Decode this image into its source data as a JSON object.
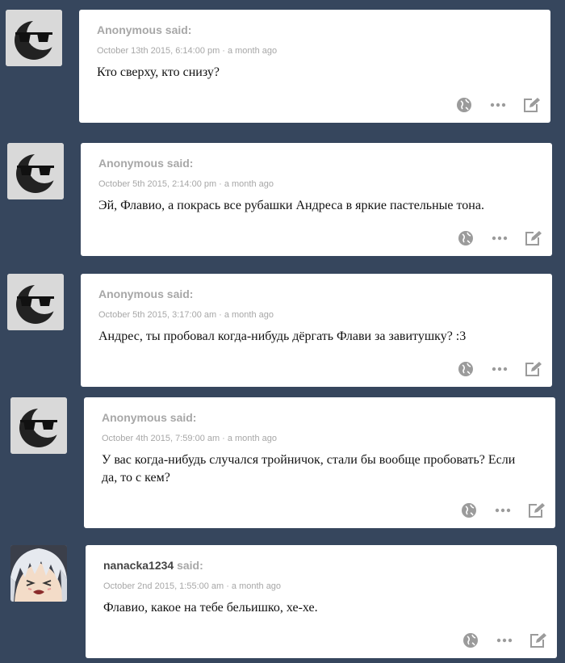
{
  "posts": [
    {
      "asker_name": "Anonymous",
      "said": "said:",
      "date": "October 13th 2015, 6:14:00 pm",
      "relative": "a month ago",
      "question": "Кто сверху, кто снизу?",
      "avatar_icon": "sunglasses-moon-icon"
    },
    {
      "asker_name": "Anonymous",
      "said": "said:",
      "date": "October 5th 2015, 2:14:00 pm",
      "relative": "a month ago",
      "question": "Эй, Флавио, а покрась все рубашки Андреса в яркие пастельные тона.",
      "avatar_icon": "sunglasses-moon-icon"
    },
    {
      "asker_name": "Anonymous",
      "said": "said:",
      "date": "October 5th 2015, 3:17:00 am",
      "relative": "a month ago",
      "question": "Андрес, ты пробовал когда-нибудь дёргать Флави за завитушку? :3",
      "avatar_icon": "sunglasses-moon-icon"
    },
    {
      "asker_name": "Anonymous",
      "said": "said:",
      "date": "October 4th 2015, 7:59:00 am",
      "relative": "a month ago",
      "question": "У вас когда-нибудь случался тройничок, стали бы вообще пробовать? Если да, то с кем?",
      "avatar_icon": "sunglasses-moon-icon"
    },
    {
      "asker_name": "nanacka1234",
      "said": "said:",
      "date": "October 2nd 2015, 1:55:00 am",
      "relative": "a month ago",
      "question": "Флавио, какое на тебе бельишко, хе-хе.",
      "avatar_icon": "anime-character-avatar"
    }
  ],
  "separator": "·",
  "action_icons": [
    "globe-icon",
    "more-dots-icon",
    "edit-icon"
  ],
  "colors": {
    "background": "#36465d",
    "card": "#ffffff",
    "meta_text": "#a7a7a7",
    "icon": "#9b9b9b"
  }
}
